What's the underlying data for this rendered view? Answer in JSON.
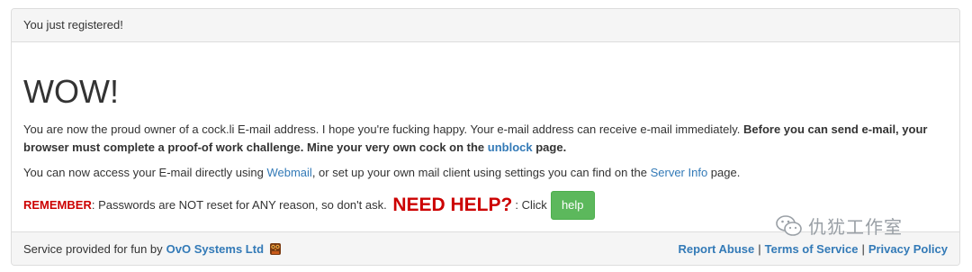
{
  "header": {
    "title": "You just registered!"
  },
  "main": {
    "headline": "WOW!",
    "p1_text": "You are now the proud owner of a cock.li E-mail address. I hope you're fucking happy. Your e-mail address can receive e-mail immediately. ",
    "p1_bold": "Before you can send e-mail, your browser must complete a proof-of work challenge. Mine your very own cock on the ",
    "p1_link": "unblock",
    "p1_bold_end": " page.",
    "p2_text_a": "You can now access your E-mail directly using ",
    "p2_link_webmail": "Webmail",
    "p2_text_b": ", or set up your own mail client using settings you can find on the ",
    "p2_link_serverinfo": "Server Info",
    "p2_text_c": " page.",
    "p3_remember": "REMEMBER",
    "p3_text": ": Passwords are NOT reset for ANY reason, so don't ask. ",
    "p3_needhelp": "NEED HELP?",
    "p3_click": ": Click",
    "help_button": "help"
  },
  "footer": {
    "service_text": "Service provided for fun by",
    "company_link": "OvO Systems Ltd",
    "links": [
      "Report Abuse",
      "Terms of Service",
      "Privacy Policy"
    ],
    "separator": "|"
  },
  "watermark": {
    "text": "仇犹工作室"
  },
  "colors": {
    "link": "#337ab7",
    "alert_red": "#cc0000",
    "help_green": "#5cb85c"
  },
  "icons": {
    "company_logo": "owl-logo-icon",
    "watermark": "wechat-icon"
  }
}
